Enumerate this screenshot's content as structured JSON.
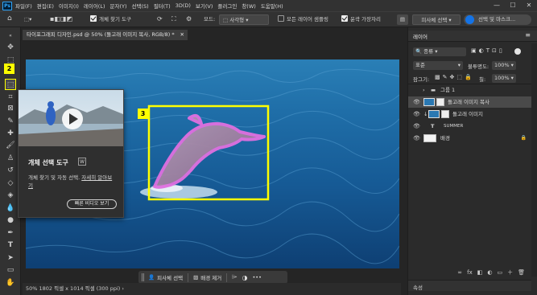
{
  "menu": {
    "app_icon": "Ps",
    "items": [
      "파일(F)",
      "편집(E)",
      "이미지(I)",
      "레이어(L)",
      "문자(Y)",
      "선택(S)",
      "필터(T)",
      "3D(D)",
      "보기(V)",
      "플러그인",
      "창(W)",
      "도움말(H)"
    ]
  },
  "window_controls": [
    "—",
    "☐",
    "✕"
  ],
  "options": {
    "object_finder_label": "개체 찾기 도구",
    "mode_label": "모드:",
    "mode_value": "사각형",
    "all_layers_label": "모든 레이어 샘플링",
    "hard_edge_label": "윤곽 가장자리",
    "select_subject_label": "피사체 선택",
    "select_mask_label": "선택 및 마스크..."
  },
  "document": {
    "tab_title": "타이포그래피 디자인.psd @ 50% (돌고래 이미지 복사, RGB/8) *",
    "close_glyph": "✕",
    "status": "50%    1802 픽셀 x 1014 픽셀 (300 ppi)  ›"
  },
  "badges": {
    "toolbar": "2",
    "canvas": "3"
  },
  "popup": {
    "title": "개체 선택 도구",
    "shortcut": "W",
    "description": "개체 찾기 및 자동 선택.",
    "link": "자세히 알아보기",
    "button": "빠른 비디오 보기"
  },
  "context_bar": {
    "select_subject": "피사체 선택",
    "remove_background": "배경 제거",
    "more": "•••"
  },
  "layers_panel": {
    "tab": "레이어",
    "filter_label": "종류",
    "blend_mode": "표준",
    "opacity_label": "불투명도:",
    "opacity_value": "100%",
    "lock_label": "잠그기:",
    "fill_label": "칠:",
    "fill_value": "100%",
    "layers": [
      {
        "name": "그룹 1",
        "kind": "group"
      },
      {
        "name": "돌고래 이미지 복사",
        "kind": "image",
        "selected": true
      },
      {
        "name": "돌고래 이미지",
        "kind": "image"
      },
      {
        "name": "SUMMER",
        "kind": "text"
      },
      {
        "name": "배경",
        "kind": "background"
      }
    ],
    "bottom_icons": [
      "∞",
      "fx",
      "◧",
      "◐",
      "▭",
      "＋",
      "🗑"
    ],
    "properties_tab": "속성"
  },
  "colors": {
    "accent_blue": "#1473e6",
    "badge_yellow": "#ffff00",
    "selection_pink": "#e070e0"
  }
}
